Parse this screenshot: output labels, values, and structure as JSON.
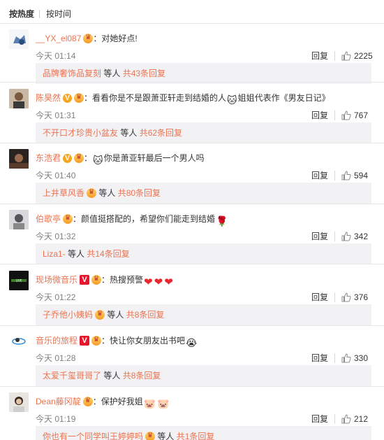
{
  "sort": {
    "hot": "按热度",
    "time": "按时间"
  },
  "reply_label": "回复",
  "comments": [
    {
      "user": "__YX_el087",
      "badges": [
        "crown"
      ],
      "text": "：对她好点!",
      "emoji": [],
      "time": "今天 01:14",
      "likes": "2225",
      "sub_user": "品牌奢饰品复刻",
      "sub_user_badges": [],
      "sub_others": " 等人 ",
      "sub_count": "共43条回复"
    },
    {
      "user": "陈昊然",
      "badges": [
        "vip",
        "crown"
      ],
      "text": "：看看你是不是跟萧亚轩走到结婚的人",
      "emoji": [
        "cat-emoji"
      ],
      "text2": "姐姐代表作《男友日记》",
      "time": "今天 01:31",
      "likes": "767",
      "sub_user": "不开口才珍贵小盆友",
      "sub_user_badges": [],
      "sub_others": " 等人 ",
      "sub_count": "共62条回复"
    },
    {
      "user": "东浩君",
      "badges": [
        "vip",
        "crown"
      ],
      "text": "：",
      "emoji": [
        "cat-emoji"
      ],
      "text2": "你是萧亚轩最后一个男人吗",
      "time": "今天 01:40",
      "likes": "594",
      "sub_user": "上井草风香",
      "sub_user_badges": [
        "crown"
      ],
      "sub_others": " 等人 ",
      "sub_count": "共80条回复"
    },
    {
      "user": "伯歌亭",
      "badges": [
        "crown"
      ],
      "text": "：颜值挺搭配的，希望你们能走到结婚",
      "emoji": [
        "rose-emoji"
      ],
      "time": "今天 01:32",
      "likes": "342",
      "sub_user": "Liza1-",
      "sub_user_badges": [],
      "sub_others": " 等人 ",
      "sub_count": "共14条回复"
    },
    {
      "user": "现场微音乐",
      "badges": [
        "vred",
        "crown"
      ],
      "text": "：热搜预警",
      "emoji": [
        "heart-emoji",
        "heart-emoji",
        "heart-emoji"
      ],
      "time": "今天 01:22",
      "likes": "376",
      "sub_user": "子乔他小姨妈",
      "sub_user_badges": [
        "crown"
      ],
      "sub_others": " 等人 ",
      "sub_count": "共8条回复"
    },
    {
      "user": "音乐的旅程",
      "badges": [
        "vred",
        "crown"
      ],
      "text": "：快让你女朋友出书吧",
      "emoji": [
        "cry-emoji"
      ],
      "time": "今天 01:28",
      "likes": "330",
      "sub_user": "太爱千玺哥哥了",
      "sub_user_badges": [],
      "sub_others": " 等人 ",
      "sub_count": "共8条回复"
    },
    {
      "user": "Dean藤冈靛",
      "badges": [
        "crown"
      ],
      "text": "：保护好我姐",
      "emoji": [
        "pig-emoji",
        "pig-emoji"
      ],
      "time": "今天 01:19",
      "likes": "212",
      "sub_user": "你也有一个同学叫王婷婷吗",
      "sub_user_badges": [
        "crown"
      ],
      "sub_others": " 等人 ",
      "sub_count": "共1条回复"
    }
  ],
  "colors": {
    "username": "#eb7350",
    "sub_bg": "#f2f2f5",
    "meta": "#808080"
  }
}
